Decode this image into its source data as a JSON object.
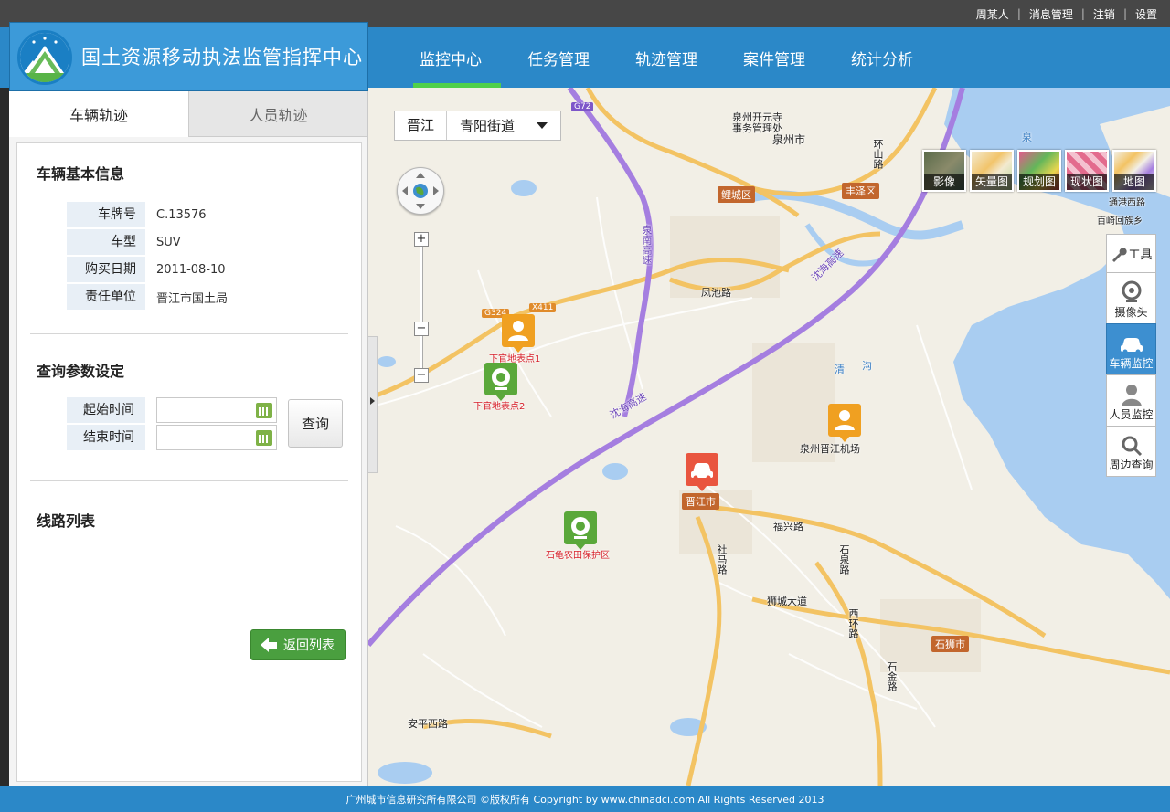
{
  "app": {
    "title": "国土资源移动执法监管指挥中心",
    "user_menu": [
      "周某人",
      "消息管理",
      "注销",
      "设置"
    ],
    "nav_tabs": [
      "监控中心",
      "任务管理",
      "轨迹管理",
      "案件管理",
      "统计分析"
    ],
    "active_nav": "监控中心"
  },
  "left_panel": {
    "tabs": [
      "车辆轨迹",
      "人员轨迹"
    ],
    "active_tab": "车辆轨迹",
    "vehicle_section_title": "车辆基本信息",
    "vehicle_info": [
      {
        "key": "车牌号",
        "value": "C.13576"
      },
      {
        "key": "车型",
        "value": "SUV"
      },
      {
        "key": "购买日期",
        "value": "2011-08-10"
      },
      {
        "key": "责任单位",
        "value": "晋江市国土局"
      }
    ],
    "query_section_title": "查询参数设定",
    "start_time_label": "起始时间",
    "end_time_label": "结束时间",
    "start_time_value": "",
    "end_time_value": "",
    "query_button": "查询",
    "route_section_title": "线路列表",
    "back_button": "返回列表"
  },
  "map": {
    "region_city": "晋江",
    "region_street": "青阳街道",
    "map_types": [
      "影像",
      "矢量图",
      "规划图",
      "现状图",
      "地图"
    ],
    "tools": [
      "工具",
      "摄像头",
      "车辆监控",
      "人员监控",
      "周边查询"
    ],
    "active_tool": "车辆监控",
    "markers": [
      {
        "type": "person",
        "label": "下官地表点1"
      },
      {
        "type": "camera",
        "label": "下官地表点2"
      },
      {
        "type": "person",
        "label": ""
      },
      {
        "type": "vehicle",
        "label": ""
      },
      {
        "type": "camera",
        "label": "石龟农田保护区"
      }
    ],
    "place_labels": [
      "泉州开元寺",
      "事务管理处",
      "泉州市",
      "鲤城区",
      "丰泽区",
      "晋江市",
      "石狮市",
      "泉州晋江机场",
      "凤池路",
      "福兴路",
      "狮城大道",
      "百崎回族乡",
      "安平西路",
      "清",
      "沟",
      "泉"
    ],
    "road_labels": [
      "沈海高速",
      "泉南高速",
      "G72",
      "G324",
      "X411",
      "社马路",
      "石泉路",
      "西环路",
      "石金路",
      "环山路",
      "通港西路"
    ],
    "colors": {
      "expressway": "#a57ee0",
      "main_road": "#f3c363",
      "water": "#a9cdf1",
      "land": "#f2efe6"
    }
  },
  "footer": {
    "text": "广州城市信息研究所有限公司 ©版权所有 Copyright by www.chinadci.com All Rights Reserved 2013"
  },
  "colors": {
    "header_blue": "#2b88c8",
    "nav_active": "#50d04a",
    "tool_active": "#3d8fd0",
    "back_button": "#4a9f3f"
  }
}
